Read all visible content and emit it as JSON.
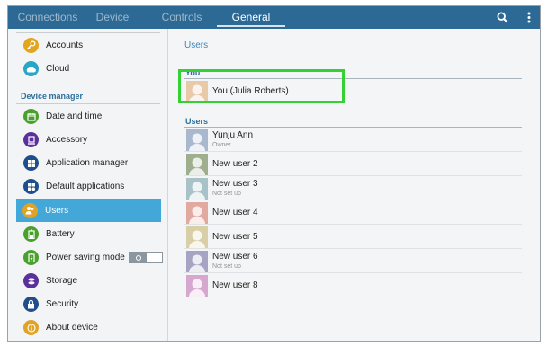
{
  "tabs": [
    {
      "label": "Connections",
      "active": false
    },
    {
      "label": "Device",
      "active": false
    },
    {
      "label": "Controls",
      "active": false
    },
    {
      "label": "General",
      "active": true
    }
  ],
  "toolbar": {
    "search_icon": "search-icon",
    "menu_icon": "overflow-menu-icon"
  },
  "sidebar": {
    "top_items": [
      {
        "label": "Accounts",
        "icon": "key-icon",
        "color": "#e2a51e"
      },
      {
        "label": "Cloud",
        "icon": "cloud-icon",
        "color": "#28a6c7"
      }
    ],
    "section_title": "Device manager",
    "items": [
      {
        "label": "Date and time",
        "icon": "calendar-icon",
        "color": "#4aa02c"
      },
      {
        "label": "Accessory",
        "icon": "accessory-icon",
        "color": "#5b2f9c"
      },
      {
        "label": "Application manager",
        "icon": "grid-icon",
        "color": "#1e4f8c"
      },
      {
        "label": "Default applications",
        "icon": "apps-icon",
        "color": "#1e4f8c"
      },
      {
        "label": "Users",
        "icon": "users-icon",
        "color": "#e0a328",
        "selected": true
      },
      {
        "label": "Battery",
        "icon": "battery-icon",
        "color": "#4aa02c"
      },
      {
        "label": "Power saving mode",
        "icon": "power-saving-icon",
        "color": "#4aa02c",
        "toggle": "O"
      },
      {
        "label": "Storage",
        "icon": "storage-icon",
        "color": "#5b2f9c"
      },
      {
        "label": "Security",
        "icon": "lock-icon",
        "color": "#1e4f8c"
      },
      {
        "label": "About device",
        "icon": "info-icon",
        "color": "#e0a328"
      }
    ]
  },
  "main": {
    "title": "Users",
    "you_section": "You",
    "you": {
      "name": "You (Julia Roberts)",
      "avatar_color": "#e8c9a8"
    },
    "users_section": "Users",
    "users": [
      {
        "name": "Yunju Ann",
        "sub": "Owner",
        "avatar_color": "#a9b8cf"
      },
      {
        "name": "New user 2",
        "sub": "",
        "avatar_color": "#9fae8f"
      },
      {
        "name": "New user 3",
        "sub": "Not set up",
        "avatar_color": "#a8c3c8"
      },
      {
        "name": "New user 4",
        "sub": "",
        "avatar_color": "#e1a9a0"
      },
      {
        "name": "New user 5",
        "sub": "",
        "avatar_color": "#d9cfa6"
      },
      {
        "name": "New user 6",
        "sub": "Not set up",
        "avatar_color": "#a7a3c2"
      },
      {
        "name": "New user 8",
        "sub": "",
        "avatar_color": "#d7a8cf"
      }
    ]
  }
}
